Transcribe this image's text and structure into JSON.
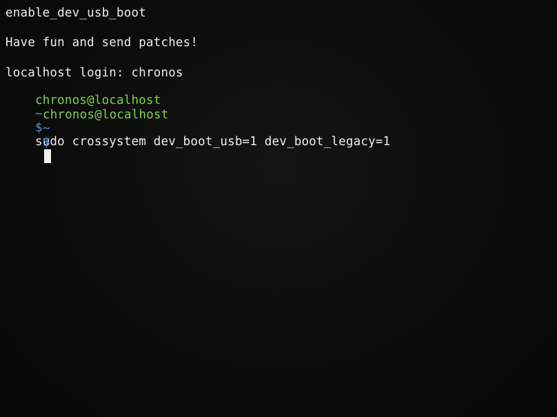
{
  "terminal": {
    "line1": "enable_dev_usb_boot",
    "line2": "Have fun and send patches!",
    "login_line": "localhost login: chronos",
    "prompt1": {
      "user_host": "chronos@localhost",
      "cwd": "~",
      "symbol": "$",
      "command": "sudo crossystem dev_boot_usb=1 dev_boot_legacy=1"
    },
    "prompt2": {
      "user_host": "chronos@localhost",
      "cwd": "~",
      "symbol": "$",
      "command": ""
    }
  },
  "colors": {
    "background": "#0b0b0b",
    "text": "#e8e8e8",
    "user_host": "#7fd34a",
    "path": "#5b8fd6",
    "cursor": "#f2f2f2"
  }
}
